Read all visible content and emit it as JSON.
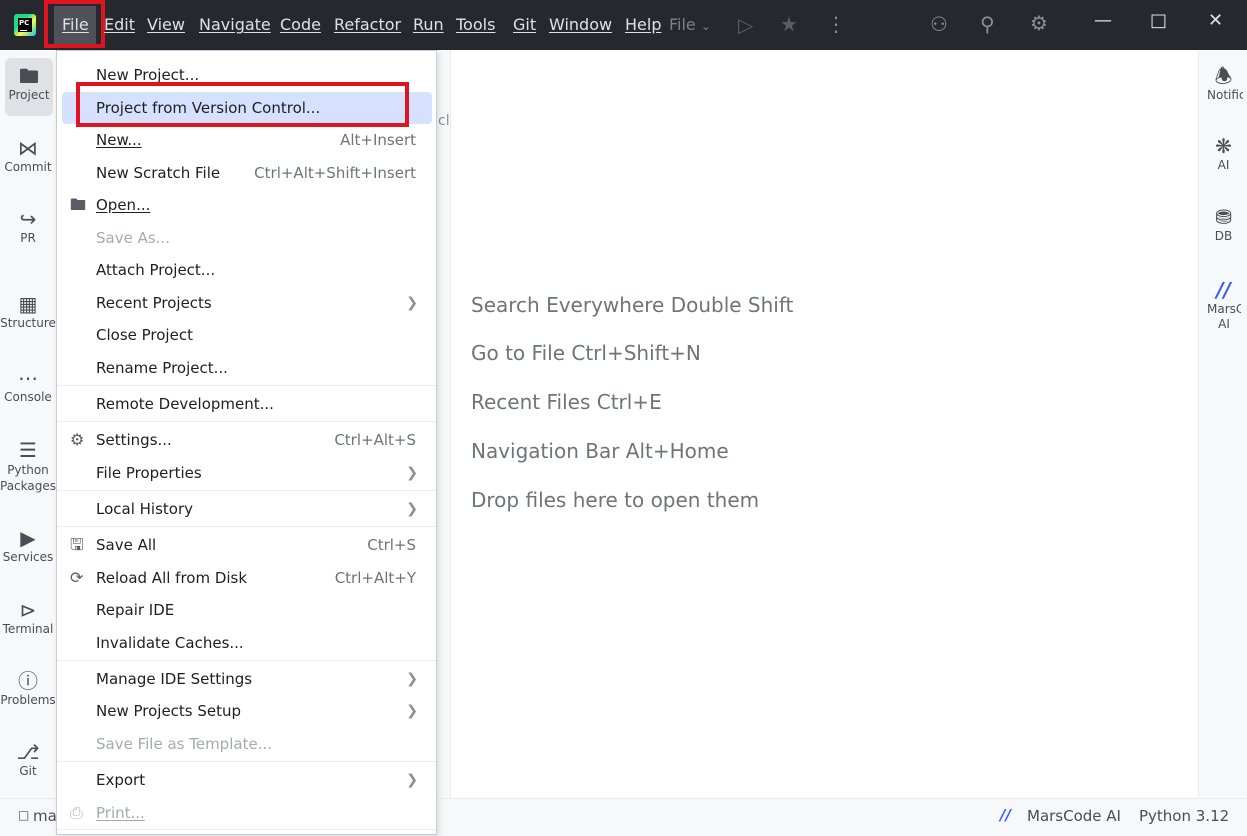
{
  "menubar": {
    "items": [
      "File",
      "Edit",
      "View",
      "Navigate",
      "Code",
      "Refactor",
      "Run",
      "Tools",
      "Git",
      "Window",
      "Help"
    ],
    "run_config": "File"
  },
  "left_tools": [
    "Project",
    "Commit",
    "PR",
    "Structure",
    "Console",
    "Python Packages",
    "Services",
    "Terminal",
    "Problems",
    "Git"
  ],
  "right_tools": [
    "Notifications",
    "AI",
    "DB",
    "MarsCode AI"
  ],
  "file_menu": {
    "new_project": "New Project...",
    "project_from_vcs": "Project from Version Control...",
    "new": "New...",
    "new_sc": "Alt+Insert",
    "new_scratch": "New Scratch File",
    "new_scratch_sc": "Ctrl+Alt+Shift+Insert",
    "open": "Open...",
    "save_as": "Save As...",
    "attach_project": "Attach Project...",
    "recent_projects": "Recent Projects",
    "close_project": "Close Project",
    "rename_project": "Rename Project...",
    "remote_development": "Remote Development...",
    "settings": "Settings...",
    "settings_sc": "Ctrl+Alt+S",
    "file_properties": "File Properties",
    "local_history": "Local History",
    "save_all": "Save All",
    "save_all_sc": "Ctrl+S",
    "reload_all": "Reload All from Disk",
    "reload_all_sc": "Ctrl+Alt+Y",
    "repair_ide": "Repair IDE",
    "invalidate_caches": "Invalidate Caches...",
    "manage_ide_settings": "Manage IDE Settings",
    "new_projects_setup": "New Projects Setup",
    "save_file_template": "Save File as Template...",
    "export": "Export",
    "print": "Print..."
  },
  "editor_hints": [
    "Search Everywhere Double Shift",
    "Go to File Ctrl+Shift+N",
    "Recent Files Ctrl+E",
    "Navigation Bar Alt+Home",
    "Drop files here to open them"
  ],
  "statusbar": {
    "left": "ma",
    "marscode": "MarsCode AI",
    "python": "Python 3.12"
  },
  "colors": {
    "titlebar": "#27282e",
    "highlight": "#d5e1ff",
    "annotation_red": "#e0141e"
  }
}
